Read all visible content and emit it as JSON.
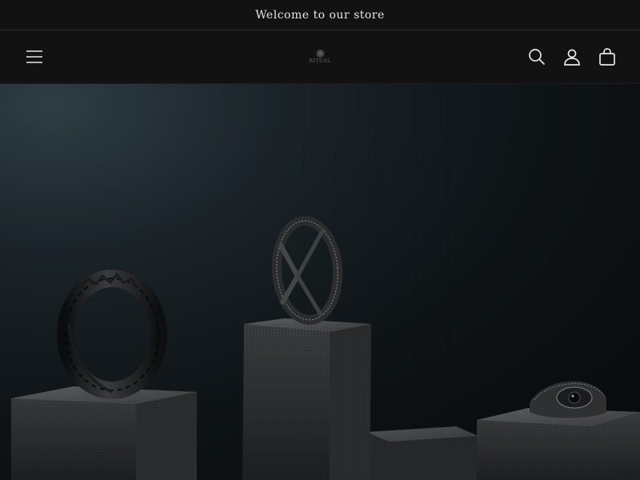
{
  "announcement": {
    "text": "Welcome to our store"
  },
  "header": {
    "menu_icon": "hamburger-menu-icon",
    "logo_text": "RITUAL",
    "search_icon": "search-icon",
    "account_icon": "account-icon",
    "cart_icon": "cart-icon"
  },
  "hero": {
    "image_subject": "three dark rings on concrete pedestals"
  },
  "colors": {
    "background": "#121212",
    "text": "#e6e6e6",
    "hero_dark": "#07090a"
  }
}
